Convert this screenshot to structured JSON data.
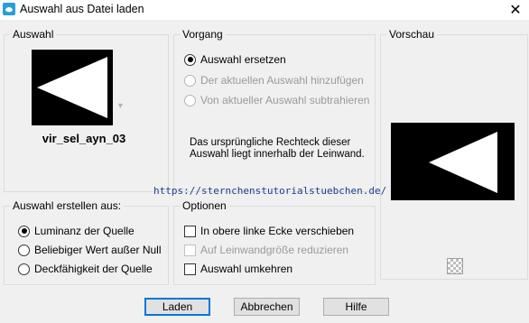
{
  "window": {
    "title": "Auswahl aus Datei laden",
    "close_glyph": "✕"
  },
  "selection_group": {
    "label": "Auswahl",
    "selection_name": "vir_sel_ayn_03",
    "dropdown_glyph": "▼"
  },
  "process_group": {
    "label": "Vorgang",
    "options": [
      {
        "label": "Auswahl ersetzen",
        "selected": true,
        "enabled": true
      },
      {
        "label": "Der aktuellen Auswahl hinzufügen",
        "selected": false,
        "enabled": false
      },
      {
        "label": "Von aktueller Auswahl subtrahieren",
        "selected": false,
        "enabled": false
      }
    ],
    "info_text": "Das ursprüngliche Rechteck dieser Auswahl liegt innerhalb der Leinwand."
  },
  "preview_group": {
    "label": "Vorschau"
  },
  "create_group": {
    "label": "Auswahl erstellen aus:",
    "options": [
      {
        "label": "Luminanz der Quelle",
        "selected": true
      },
      {
        "label": "Beliebiger Wert außer Null",
        "selected": false
      },
      {
        "label": "Deckfähigkeit der Quelle",
        "selected": false
      }
    ]
  },
  "options_group": {
    "label": "Optionen",
    "checks": [
      {
        "label": "In obere linke Ecke verschieben",
        "checked": false,
        "enabled": true
      },
      {
        "label": "Auf Leinwandgröße reduzieren",
        "checked": false,
        "enabled": false
      },
      {
        "label": "Auswahl umkehren",
        "checked": false,
        "enabled": true
      }
    ]
  },
  "watermark": "https://sternchenstutorialstuebchen.de/",
  "buttons": {
    "load": "Laden",
    "cancel": "Abbrechen",
    "help": "Hilfe"
  },
  "colors": {
    "accent": "#0078d7",
    "app_icon": "#26a0da",
    "watermark": "#1f3f8f"
  }
}
